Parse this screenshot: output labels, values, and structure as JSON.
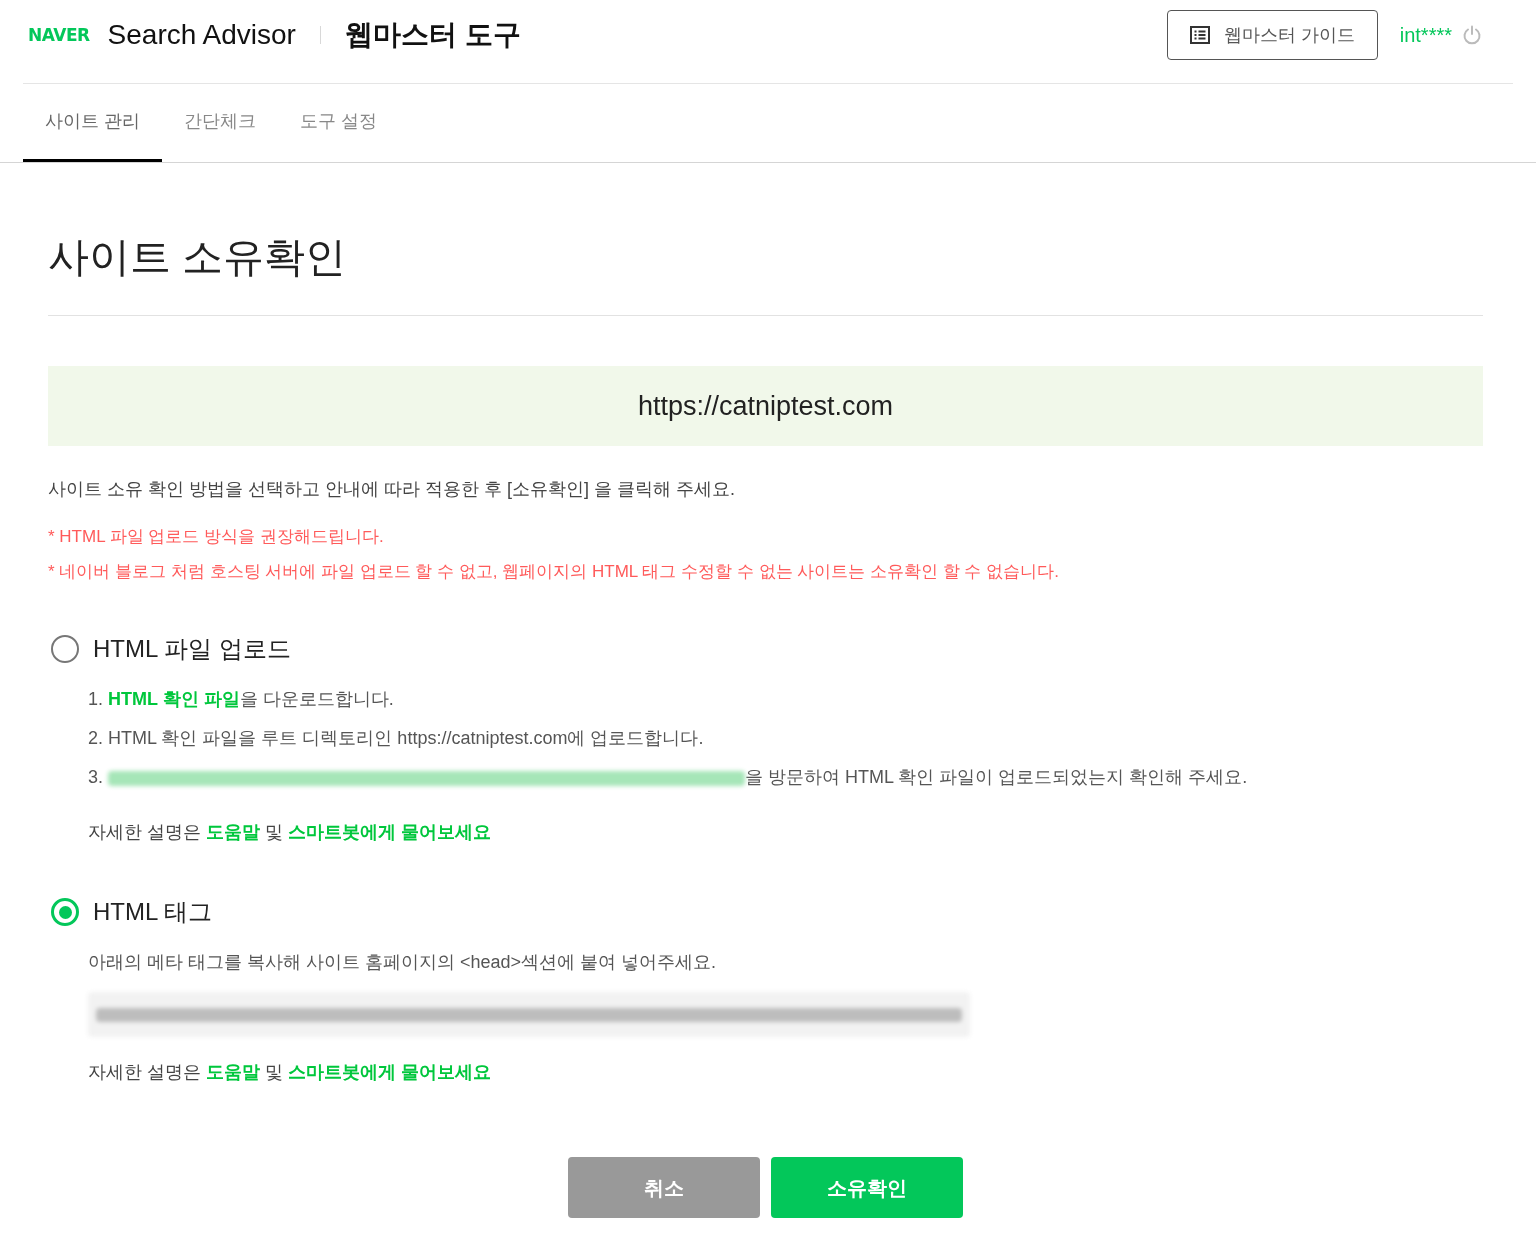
{
  "header": {
    "logo": "NAVER",
    "product": "Search Advisor",
    "section": "웹마스터 도구",
    "guide_button": "웹마스터 가이드",
    "user": "int****"
  },
  "tabs": [
    {
      "label": "사이트 관리",
      "selected": true
    },
    {
      "label": "간단체크",
      "selected": false
    },
    {
      "label": "도구 설정",
      "selected": false
    }
  ],
  "page_title": "사이트 소유확인",
  "site_url": "https://catniptest.com",
  "instruction": "사이트 소유 확인 방법을 선택하고 안내에 따라 적용한 후 [소유확인] 을 클릭해 주세요.",
  "notes": [
    "* HTML 파일 업로드 방식을 권장해드립니다.",
    "* 네이버 블로그 처럼 호스팅 서버에 파일 업로드 할 수 없고, 웹페이지의 HTML 태그 수정할 수 없는 사이트는 소유확인 할 수 없습니다."
  ],
  "methods": [
    {
      "label": "HTML 파일 업로드",
      "selected": false,
      "steps": [
        {
          "number": "1.",
          "parts": [
            {
              "kind": "link",
              "text": "HTML 확인 파일"
            },
            {
              "kind": "text",
              "text": "을 다운로드합니다."
            }
          ]
        },
        {
          "number": "2.",
          "parts": [
            {
              "kind": "text",
              "text": "HTML 확인 파일을 루트 디렉토리인 https://catniptest.com에 업로드합니다."
            }
          ]
        },
        {
          "number": "3.",
          "parts": [
            {
              "kind": "blurred"
            },
            {
              "kind": "text",
              "text": "을 방문하여 HTML 확인 파일이 업로드되었는지 확인해 주세요."
            }
          ]
        }
      ],
      "help": [
        {
          "kind": "text",
          "text": "자세한 설명은 "
        },
        {
          "kind": "link",
          "text": "도움말"
        },
        {
          "kind": "text",
          "text": " 및 "
        },
        {
          "kind": "link",
          "text": "스마트봇에게 물어보세요"
        }
      ]
    },
    {
      "label": "HTML 태그",
      "selected": true,
      "description": "아래의 메타 태그를 복사해 사이트 홈페이지의 <head>섹션에 붙여 넣어주세요.",
      "code_field": {
        "kind": "blurred"
      },
      "help": [
        {
          "kind": "text",
          "text": "자세한 설명은 "
        },
        {
          "kind": "link",
          "text": "도움말"
        },
        {
          "kind": "text",
          "text": " 및 "
        },
        {
          "kind": "link",
          "text": "스마트봇에게 물어보세요"
        }
      ]
    }
  ],
  "buttons": [
    {
      "kind": "cancel",
      "label": "취소"
    },
    {
      "kind": "primary",
      "label": "소유확인"
    }
  ]
}
